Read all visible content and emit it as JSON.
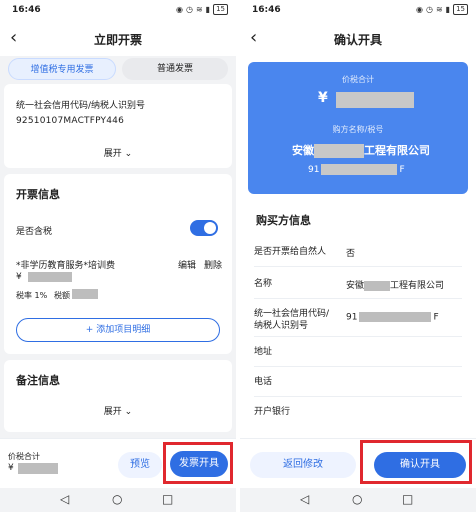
{
  "status_bar": {
    "time": "16:46",
    "battery": "15"
  },
  "left": {
    "title": "立即开票",
    "tabs": [
      "增值税专用发票",
      "普通发票"
    ],
    "buyer": {
      "credit_code_label": "统一社会信用代码/纳税人识别号",
      "credit_code_value": "92510107MACTFPY446",
      "expand": "展开"
    },
    "invoice_info": {
      "heading": "开票信息",
      "tax_included_label": "是否含税",
      "tax_included": true,
      "item_name": "*非学历教育服务*培训费",
      "edit": "编辑",
      "delete": "删除",
      "currency": "¥",
      "tax_rate": "税率 1%",
      "tax_amount_label": "税额",
      "add_item": "+ 添加项目明细"
    },
    "remarks": {
      "heading": "备注信息",
      "expand": "展开"
    },
    "bottom": {
      "total_label": "价税合计",
      "currency": "¥",
      "preview": "预览",
      "issue": "发票开具"
    }
  },
  "right": {
    "title": "确认开具",
    "summary": {
      "total_label": "价税合计",
      "currency": "¥",
      "buyer_label": "购方名称/税号",
      "company_prefix": "安徽",
      "company_suffix": "工程有限公司",
      "tax_prefix": "91",
      "tax_suffix": "F"
    },
    "buyer_info": {
      "heading": "购买方信息",
      "natural_person_label": "是否开票给自然人",
      "natural_person_value": "否",
      "name_label": "名称",
      "name_prefix": "安徽",
      "name_suffix": "工程有限公司",
      "code_label": "统一社会信用代码/纳税人识别号",
      "code_prefix": "91",
      "code_suffix": "F",
      "address_label": "地址",
      "phone_label": "电话",
      "bank_label": "开户银行"
    },
    "bottom": {
      "back": "返回修改",
      "confirm": "确认开具"
    }
  },
  "system_nav": {
    "back": "◁",
    "home": "○",
    "recent": "□"
  },
  "colors": {
    "accent": "#2f6ee3",
    "summary_card": "#4a86ee",
    "highlight": "#e0282e",
    "delete": "#e53935"
  }
}
